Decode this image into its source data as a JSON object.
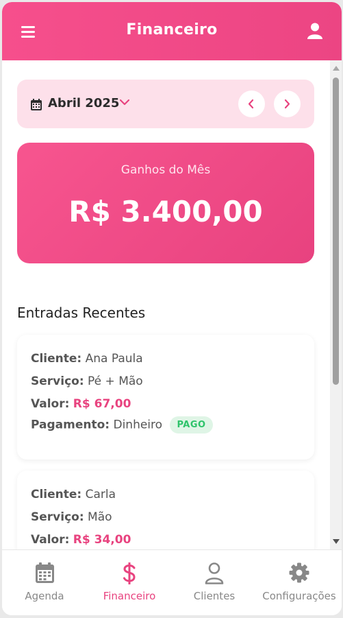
{
  "header": {
    "title": "Financeiro",
    "menu_icon": "hamburger-menu-icon",
    "user_icon": "user-icon"
  },
  "month_selector": {
    "label": "Abril 2025",
    "icon": "calendar-icon"
  },
  "earnings": {
    "label": "Ganhos do Mês",
    "value": "R$ 3.400,00"
  },
  "recent": {
    "title": "Entradas Recentes",
    "entries": [
      {
        "cliente_label": "Cliente:",
        "cliente": "Ana Paula",
        "servico_label": "Serviço:",
        "servico": "Pé + Mão",
        "valor_label": "Valor:",
        "valor": "R$ 67,00",
        "pagamento_label": "Pagamento:",
        "pagamento": "Dinheiro",
        "status": "PAGO"
      },
      {
        "cliente_label": "Cliente:",
        "cliente": "Carla",
        "servico_label": "Serviço:",
        "servico": "Mão",
        "valor_label": "Valor:",
        "valor": "R$ 34,00"
      }
    ]
  },
  "bottom_nav": [
    {
      "label": "Agenda",
      "icon": "calendar-icon",
      "active": false
    },
    {
      "label": "Financeiro",
      "icon": "dollar-icon",
      "active": true
    },
    {
      "label": "Clientes",
      "icon": "user-icon",
      "active": false
    },
    {
      "label": "Configurações",
      "icon": "gear-icon",
      "active": false
    }
  ],
  "colors": {
    "primary": "#f04f8a",
    "light_pink": "#fde0ea",
    "paid_green": "#2ec36a"
  }
}
